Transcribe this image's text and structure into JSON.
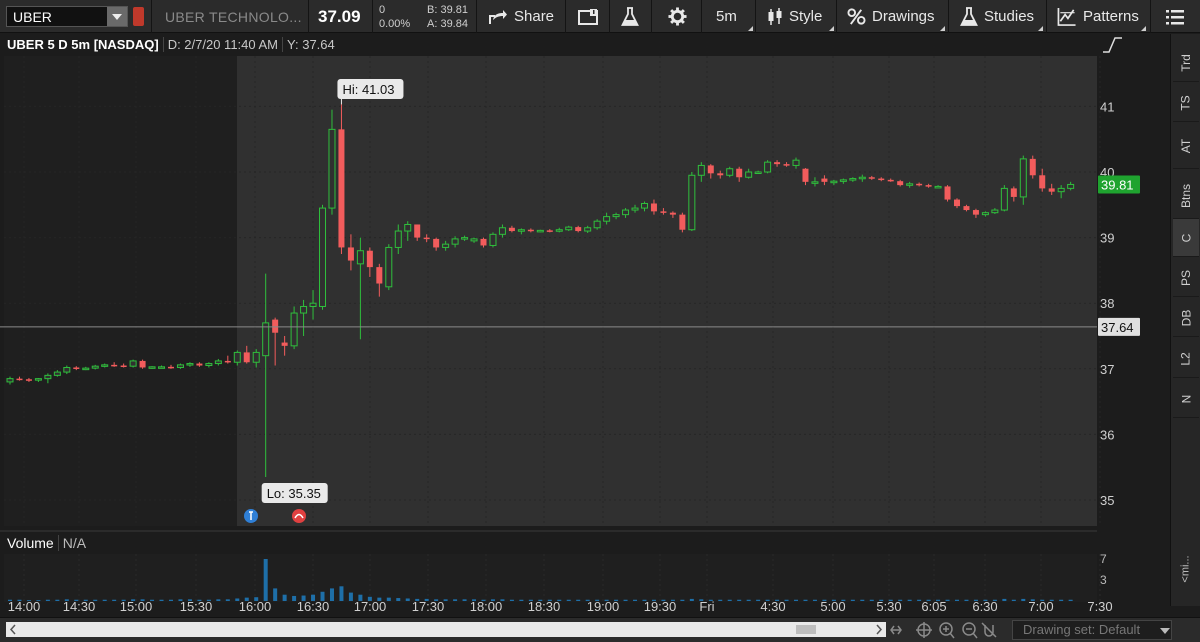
{
  "toolbar": {
    "symbol": "UBER",
    "company_name": "UBER TECHNOLO...",
    "last_price": "37.09",
    "net_change": "0",
    "pct_change": "0.00%",
    "bid": "B: 39.81",
    "ask": "A: 39.84",
    "share_label": "Share",
    "aggregation_label": "5m",
    "style_label": "Style",
    "drawings_label": "Drawings",
    "studies_label": "Studies",
    "patterns_label": "Patterns"
  },
  "chart": {
    "title": "UBER 5 D 5m [NASDAQ]",
    "cursor_date": "D: 2/7/20 11:40 AM",
    "cursor_y": "Y: 37.64",
    "hi_label": "Hi: 41.03",
    "lo_label": "Lo: 35.35",
    "last_price_tag": "39.81",
    "crosshair_tag": "37.64",
    "crosshair_value": 37.64,
    "last_value": 39.81,
    "colors": {
      "up": "#2fbf3c",
      "down": "#f25c5c",
      "volume": "#1e6fa8",
      "last_tag_bg": "#1fa32f"
    }
  },
  "volume_panel": {
    "title": "Volume",
    "value": "N/A",
    "ticks": [
      "7",
      "3"
    ]
  },
  "side_tabs": [
    "Trd",
    "TS",
    "AT",
    "Btns",
    "C",
    "PS",
    "DB",
    "L2",
    "N"
  ],
  "active_side_tab": "C",
  "collapse_label": "<mi...",
  "bottom": {
    "drawing_set": "Drawing set: Default"
  },
  "chart_data": {
    "type": "candlestick",
    "title": "UBER 5 D 5m [NASDAQ]",
    "ylim": [
      34.6,
      41.8
    ],
    "y_ticks": [
      35,
      36,
      37,
      38,
      39,
      40,
      41
    ],
    "x_ticks": [
      "14:00",
      "14:30",
      "15:00",
      "15:30",
      "16:00",
      "16:30",
      "17:00",
      "17:30",
      "18:00",
      "18:30",
      "19:00",
      "19:30",
      "Fri",
      "4:30",
      "5:00",
      "5:30",
      "6:05",
      "6:30",
      "7:00",
      "7:30"
    ],
    "candles": [
      [
        36.8,
        36.88,
        36.76,
        36.85
      ],
      [
        36.85,
        36.88,
        36.82,
        36.84
      ],
      [
        36.84,
        36.86,
        36.8,
        36.83
      ],
      [
        36.83,
        36.86,
        36.8,
        36.85
      ],
      [
        36.85,
        36.93,
        36.78,
        36.9
      ],
      [
        36.9,
        36.98,
        36.88,
        36.95
      ],
      [
        36.95,
        37.05,
        36.92,
        37.02
      ],
      [
        37.02,
        37.04,
        36.98,
        37.0
      ],
      [
        37.0,
        37.03,
        36.98,
        37.01
      ],
      [
        37.01,
        37.06,
        36.99,
        37.04
      ],
      [
        37.04,
        37.08,
        37.02,
        37.06
      ],
      [
        37.06,
        37.1,
        37.03,
        37.05
      ],
      [
        37.05,
        37.08,
        37.02,
        37.04
      ],
      [
        37.04,
        37.14,
        37.02,
        37.12
      ],
      [
        37.12,
        37.14,
        37.0,
        37.02
      ],
      [
        37.02,
        37.04,
        37.0,
        37.03
      ],
      [
        37.03,
        37.05,
        37.01,
        37.03
      ],
      [
        37.03,
        37.06,
        37.0,
        37.02
      ],
      [
        37.02,
        37.08,
        37.0,
        37.06
      ],
      [
        37.06,
        37.1,
        37.03,
        37.08
      ],
      [
        37.08,
        37.1,
        37.03,
        37.05
      ],
      [
        37.05,
        37.1,
        37.02,
        37.08
      ],
      [
        37.08,
        37.15,
        37.05,
        37.12
      ],
      [
        37.12,
        37.2,
        37.08,
        37.1
      ],
      [
        37.1,
        37.28,
        37.05,
        37.25
      ],
      [
        37.25,
        37.35,
        37.08,
        37.1
      ],
      [
        37.1,
        37.3,
        37.02,
        37.25
      ],
      [
        37.2,
        38.45,
        35.35,
        37.7
      ],
      [
        37.75,
        37.78,
        37.05,
        37.55
      ],
      [
        37.4,
        37.5,
        37.2,
        37.35
      ],
      [
        37.35,
        37.95,
        37.3,
        37.85
      ],
      [
        37.85,
        38.05,
        37.5,
        37.95
      ],
      [
        37.95,
        38.2,
        37.75,
        38.0
      ],
      [
        37.95,
        39.5,
        37.9,
        39.45
      ],
      [
        39.45,
        40.95,
        39.35,
        40.65
      ],
      [
        40.65,
        41.03,
        38.75,
        38.85
      ],
      [
        38.85,
        39.05,
        38.5,
        38.65
      ],
      [
        38.6,
        39.0,
        37.45,
        38.8
      ],
      [
        38.8,
        38.85,
        38.4,
        38.55
      ],
      [
        38.55,
        38.6,
        38.1,
        38.3
      ],
      [
        38.25,
        38.9,
        38.2,
        38.85
      ],
      [
        38.85,
        39.2,
        38.75,
        39.1
      ],
      [
        39.1,
        39.25,
        38.95,
        39.2
      ],
      [
        39.2,
        39.2,
        38.95,
        39.0
      ],
      [
        39.0,
        39.05,
        38.93,
        38.98
      ],
      [
        38.98,
        39.0,
        38.8,
        38.85
      ],
      [
        38.85,
        38.95,
        38.8,
        38.9
      ],
      [
        38.9,
        39.02,
        38.85,
        38.98
      ],
      [
        38.98,
        39.03,
        38.95,
        39.0
      ],
      [
        38.95,
        39.0,
        38.92,
        38.98
      ],
      [
        38.98,
        39.0,
        38.85,
        38.88
      ],
      [
        38.88,
        39.08,
        38.85,
        39.05
      ],
      [
        39.05,
        39.2,
        39.0,
        39.15
      ],
      [
        39.15,
        39.18,
        39.08,
        39.1
      ],
      [
        39.1,
        39.14,
        39.05,
        39.12
      ],
      [
        39.12,
        39.14,
        39.08,
        39.1
      ],
      [
        39.1,
        39.12,
        39.08,
        39.11
      ],
      [
        39.11,
        39.13,
        39.08,
        39.1
      ],
      [
        39.1,
        39.15,
        39.08,
        39.12
      ],
      [
        39.12,
        39.18,
        39.1,
        39.16
      ],
      [
        39.16,
        39.18,
        39.08,
        39.1
      ],
      [
        39.1,
        39.18,
        39.07,
        39.15
      ],
      [
        39.15,
        39.28,
        39.12,
        39.25
      ],
      [
        39.25,
        39.38,
        39.2,
        39.32
      ],
      [
        39.32,
        39.38,
        39.28,
        39.35
      ],
      [
        39.35,
        39.45,
        39.3,
        39.42
      ],
      [
        39.42,
        39.5,
        39.38,
        39.45
      ],
      [
        39.45,
        39.55,
        39.4,
        39.52
      ],
      [
        39.52,
        39.58,
        39.35,
        39.4
      ],
      [
        39.4,
        39.45,
        39.35,
        39.38
      ],
      [
        39.38,
        39.4,
        39.3,
        39.35
      ],
      [
        39.35,
        39.38,
        39.08,
        39.12
      ],
      [
        39.12,
        40.0,
        39.1,
        39.95
      ],
      [
        39.95,
        40.15,
        39.85,
        40.1
      ],
      [
        40.1,
        40.12,
        39.9,
        39.98
      ],
      [
        39.98,
        40.02,
        39.9,
        39.95
      ],
      [
        39.95,
        40.08,
        39.92,
        40.05
      ],
      [
        40.05,
        40.08,
        39.85,
        39.92
      ],
      [
        39.92,
        40.05,
        39.9,
        40.0
      ],
      [
        40.0,
        40.02,
        39.97,
        40.0
      ],
      [
        40.0,
        40.18,
        39.98,
        40.15
      ],
      [
        40.15,
        40.18,
        40.08,
        40.12
      ],
      [
        40.12,
        40.15,
        40.08,
        40.1
      ],
      [
        40.1,
        40.22,
        40.05,
        40.18
      ],
      [
        40.05,
        40.06,
        39.8,
        39.85
      ],
      [
        39.85,
        39.92,
        39.78,
        39.85
      ],
      [
        39.9,
        39.95,
        39.8,
        39.85
      ],
      [
        39.85,
        39.88,
        39.8,
        39.86
      ],
      [
        39.86,
        39.9,
        39.82,
        39.88
      ],
      [
        39.88,
        39.92,
        39.85,
        39.9
      ],
      [
        39.9,
        39.96,
        39.85,
        39.92
      ],
      [
        39.92,
        39.94,
        39.88,
        39.9
      ],
      [
        39.9,
        39.92,
        39.86,
        39.88
      ],
      [
        39.88,
        39.9,
        39.85,
        39.86
      ],
      [
        39.86,
        39.88,
        39.78,
        39.8
      ],
      [
        39.8,
        39.85,
        39.76,
        39.82
      ],
      [
        39.82,
        39.84,
        39.78,
        39.8
      ],
      [
        39.8,
        39.82,
        39.76,
        39.78
      ],
      [
        39.78,
        39.8,
        39.76,
        39.78
      ],
      [
        39.78,
        39.8,
        39.55,
        39.58
      ],
      [
        39.58,
        39.6,
        39.45,
        39.48
      ],
      [
        39.48,
        39.5,
        39.4,
        39.42
      ],
      [
        39.42,
        39.44,
        39.3,
        39.35
      ],
      [
        39.35,
        39.4,
        39.32,
        39.38
      ],
      [
        39.38,
        39.45,
        39.36,
        39.42
      ],
      [
        39.42,
        39.8,
        39.4,
        39.75
      ],
      [
        39.75,
        39.78,
        39.55,
        39.62
      ],
      [
        39.62,
        40.25,
        39.5,
        40.2
      ],
      [
        40.2,
        40.25,
        39.9,
        39.95
      ],
      [
        39.95,
        40.05,
        39.7,
        39.75
      ],
      [
        39.75,
        39.82,
        39.65,
        39.7
      ],
      [
        39.7,
        39.8,
        39.6,
        39.75
      ],
      [
        39.75,
        39.85,
        39.72,
        39.81
      ]
    ],
    "volume": [
      0.3,
      0.3,
      0.2,
      0.2,
      0.3,
      0.3,
      0.4,
      0.3,
      0.3,
      0.3,
      0.3,
      0.3,
      0.3,
      0.4,
      0.4,
      0.3,
      0.3,
      0.3,
      0.4,
      0.4,
      0.3,
      0.3,
      0.4,
      0.4,
      0.6,
      0.8,
      0.9,
      10,
      3,
      1.5,
      1.2,
      1.3,
      1.5,
      2.2,
      3.0,
      3.5,
      2.0,
      1.5,
      1.0,
      0.8,
      0.8,
      0.7,
      0.6,
      0.5,
      0.5,
      0.4,
      0.4,
      0.4,
      0.4,
      0.4,
      0.3,
      0.4,
      0.4,
      0.3,
      0.3,
      0.3,
      0.3,
      0.3,
      0.3,
      0.3,
      0.3,
      0.3,
      0.3,
      0.3,
      0.3,
      0.3,
      0.3,
      0.3,
      0.3,
      0.3,
      0.3,
      0.3,
      0.5,
      0.4,
      0.3,
      0.3,
      0.3,
      0.3,
      0.3,
      0.3,
      0.3,
      0.3,
      0.3,
      0.3,
      0.3,
      0.3,
      0.3,
      0.3,
      0.3,
      0.3,
      0.3,
      0.3,
      0.3,
      0.3,
      0.3,
      0.3,
      0.3,
      0.3,
      0.3,
      0.3,
      0.3,
      0.3,
      0.3,
      0.3,
      0.3,
      0.5,
      0.3,
      0.5,
      0.4,
      0.3,
      0.3,
      0.3,
      0.3
    ]
  }
}
